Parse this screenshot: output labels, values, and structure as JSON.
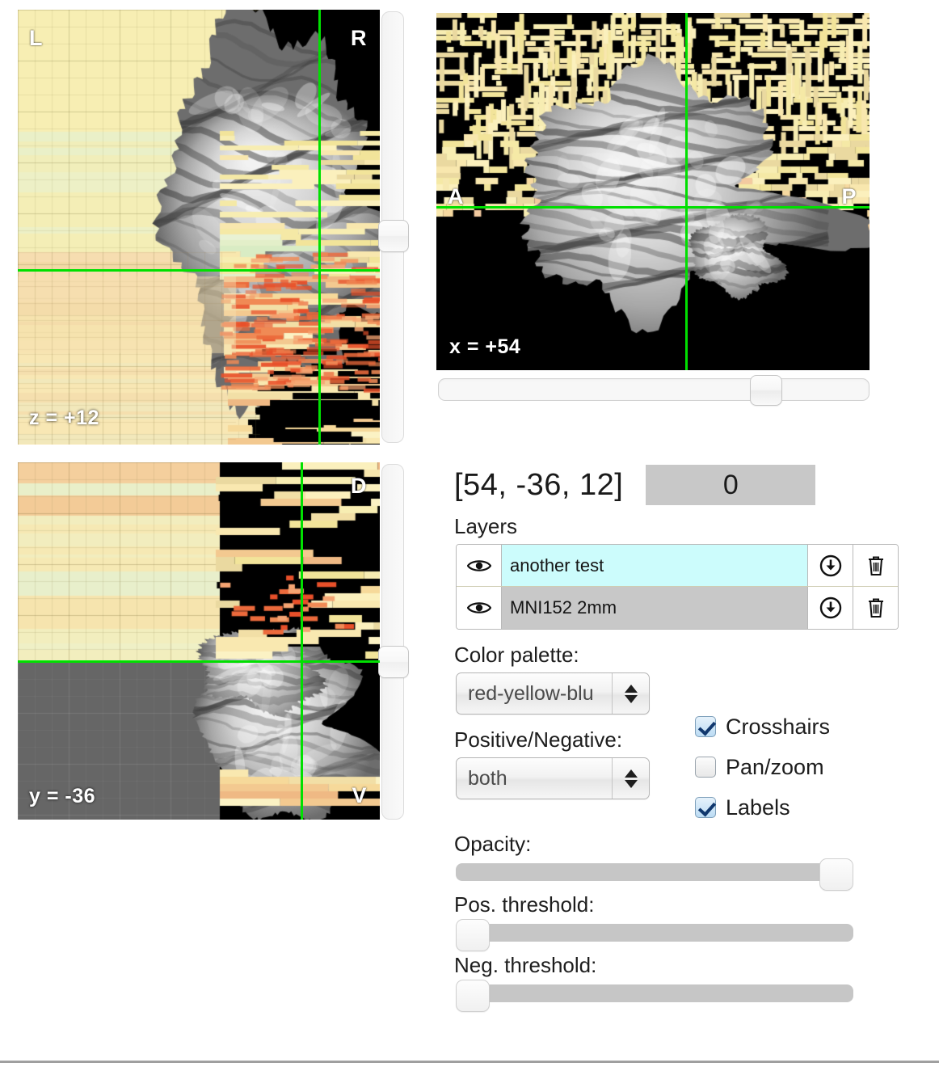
{
  "viewer": {
    "panels": [
      {
        "id": "axial",
        "name": "axial-view",
        "slice_label": "z = +12",
        "orient_left": "L",
        "orient_right": "R"
      },
      {
        "id": "sagittal",
        "name": "sagittal-view",
        "slice_label": "x = +54",
        "orient_left": "A",
        "orient_right": "P"
      },
      {
        "id": "coronal",
        "name": "coronal-view",
        "slice_label": "y = -36",
        "orient_left": "D",
        "orient_right": "V"
      }
    ],
    "crosshair_color": "#00e000"
  },
  "readout": {
    "coordinates": "[54, -36, 12]",
    "voxel_value": "0"
  },
  "layers_panel": {
    "heading": "Layers",
    "rows": [
      {
        "name": "another test",
        "visible": true,
        "selected": true,
        "eye_icon": "eye-icon",
        "download_icon": "download-circle-icon",
        "delete_icon": "trash-icon"
      },
      {
        "name": "MNI152 2mm",
        "visible": true,
        "selected": false,
        "eye_icon": "eye-icon",
        "download_icon": "download-circle-icon",
        "delete_icon": "trash-icon"
      }
    ]
  },
  "settings": {
    "color_palette": {
      "label": "Color palette:",
      "value": "red-yellow-blue",
      "display": "red-yellow-blu"
    },
    "positive_negative": {
      "label": "Positive/Negative:",
      "value": "both"
    },
    "checkboxes": [
      {
        "label": "Crosshairs",
        "checked": true
      },
      {
        "label": "Pan/zoom",
        "checked": false
      },
      {
        "label": "Labels",
        "checked": true
      }
    ]
  },
  "sliders": {
    "opacity": {
      "label": "Opacity:",
      "percent": 100
    },
    "pos_threshold": {
      "label": "Pos. threshold:",
      "percent": 0
    },
    "neg_threshold": {
      "label": "Neg. threshold:",
      "percent": 0
    },
    "axial_nav": {
      "percent": 52
    },
    "coronal_nav": {
      "percent": 56
    },
    "sagittal_nav": {
      "percent": 78
    }
  }
}
